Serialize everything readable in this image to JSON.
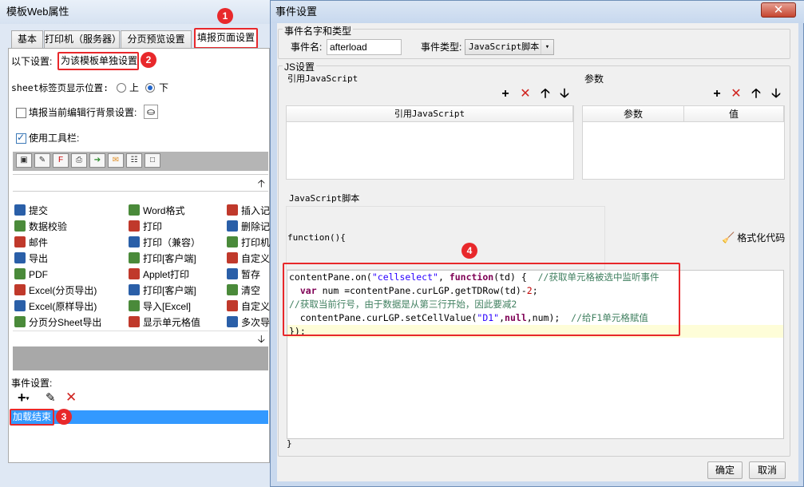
{
  "left_window": {
    "title": "模板Web属性",
    "tabs": [
      "基本",
      "打印机（服务器）",
      "分页预览设置",
      "填报页面设置"
    ],
    "settings_prefix": "以下设置:",
    "settings_scope": "为该模板单独设置",
    "sheet_tab_label": "sheet标签页显示位置:",
    "sheet_tab_options": [
      "上",
      "下"
    ],
    "sheet_tab_selected": "下",
    "bg_color_label": "填报当前编辑行背景设置:",
    "use_toolbar_label": "使用工具栏:",
    "button_list": [
      [
        "提交",
        "Word格式",
        "插入记"
      ],
      [
        "数据校验",
        "打印",
        "删除记"
      ],
      [
        "邮件",
        "打印（兼容）",
        "打印机"
      ],
      [
        "导出",
        "打印[客户端]",
        "自定义"
      ],
      [
        "PDF",
        "Applet打印",
        "暂存"
      ],
      [
        "Excel(分页导出)",
        "打印[客户端]",
        "清空"
      ],
      [
        "Excel(原样导出)",
        "导入[Excel]",
        "自定义"
      ],
      [
        "分页分Sheet导出",
        "显示单元格值",
        "多次导"
      ]
    ],
    "event_settings_label": "事件设置:",
    "event_item": "加载结束",
    "badges": [
      "1",
      "2",
      "3"
    ]
  },
  "dialog": {
    "title": "事件设置",
    "close_glyph": "✕",
    "name_type_group": "事件名字和类型",
    "event_name_label": "事件名:",
    "event_name_value": "afterload",
    "event_type_label": "事件类型:",
    "event_type_value": "JavaScript脚本",
    "js_group": "JS设置",
    "ref_js_label": "引用JavaScript",
    "params_label": "参数",
    "ref_js_header": "引用JavaScript",
    "params_headers": [
      "参数",
      "值"
    ],
    "script_label": "JavaScript脚本",
    "function_header": "function(){",
    "format_code_label": "格式化代码",
    "code_lines": [
      "contentPane.on(\"cellselect\", function(td) {  //获取单元格被选中监听事件",
      "  var num =contentPane.curLGP.getTDRow(td)-2;",
      "//获取当前行号，由于数据是从第三行开始，因此要减2",
      "  contentPane.curLGP.setCellValue(\"D1\",null,num);  //给F1单元格赋值",
      "});"
    ],
    "closing_brace": "}",
    "ok_label": "确定",
    "cancel_label": "取消",
    "badge": "4"
  },
  "colors": {
    "accent_red": "#e8282b",
    "selection_blue": "#3399ff",
    "highlight_yellow": "#fefdd8"
  }
}
